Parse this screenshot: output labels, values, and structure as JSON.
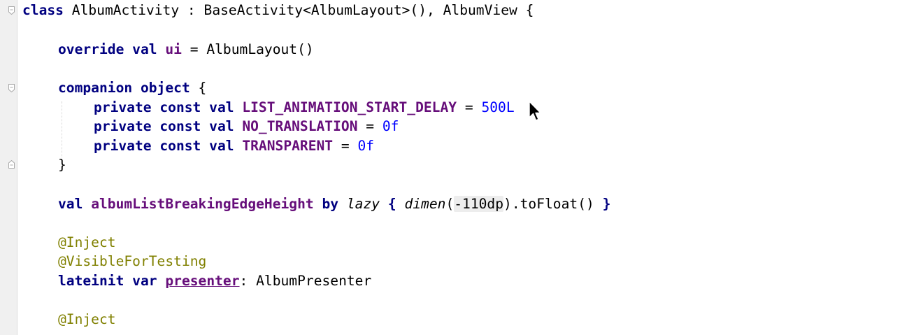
{
  "editor": {
    "lines": [
      [
        {
          "text": "class",
          "style": "kw"
        },
        {
          "text": " AlbumActivity : BaseActivity<AlbumLayout>(), AlbumView {",
          "style": "plain"
        }
      ],
      [
        {
          "text": "override val",
          "style": "kw"
        },
        {
          "text": " ",
          "style": "plain"
        },
        {
          "text": "ui",
          "style": "const"
        },
        {
          "text": " = AlbumLayout()",
          "style": "plain"
        }
      ],
      [
        {
          "text": "companion object",
          "style": "kw"
        },
        {
          "text": " {",
          "style": "plain"
        }
      ],
      [
        {
          "text": "private const val",
          "style": "kw"
        },
        {
          "text": " ",
          "style": "plain"
        },
        {
          "text": "LIST_ANIMATION_START_DELAY",
          "style": "const"
        },
        {
          "text": " = ",
          "style": "plain"
        },
        {
          "text": "500L",
          "style": "num"
        }
      ],
      [
        {
          "text": "private const val",
          "style": "kw"
        },
        {
          "text": " ",
          "style": "plain"
        },
        {
          "text": "NO_TRANSLATION",
          "style": "const"
        },
        {
          "text": " = ",
          "style": "plain"
        },
        {
          "text": "0f",
          "style": "num"
        }
      ],
      [
        {
          "text": "private const val",
          "style": "kw"
        },
        {
          "text": " ",
          "style": "plain"
        },
        {
          "text": "TRANSPARENT",
          "style": "const"
        },
        {
          "text": " = ",
          "style": "plain"
        },
        {
          "text": "0f",
          "style": "num"
        }
      ],
      [
        {
          "text": "}",
          "style": "plain"
        }
      ],
      [
        {
          "text": "val",
          "style": "kw"
        },
        {
          "text": " ",
          "style": "plain"
        },
        {
          "text": "albumListBreakingEdgeHeight",
          "style": "const"
        },
        {
          "text": " ",
          "style": "plain"
        },
        {
          "text": "by",
          "style": "kw"
        },
        {
          "text": " ",
          "style": "plain"
        },
        {
          "text": "lazy",
          "style": "italic"
        },
        {
          "text": " ",
          "style": "plain"
        },
        {
          "text": "{",
          "style": "kw"
        },
        {
          "text": " ",
          "style": "plain"
        },
        {
          "text": "dimen",
          "style": "italic"
        },
        {
          "text": "(",
          "style": "plain"
        },
        {
          "text": "-110dp",
          "style": "hl"
        },
        {
          "text": ").toFloat() ",
          "style": "plain"
        },
        {
          "text": "}",
          "style": "kw"
        }
      ],
      [
        {
          "text": "@Inject",
          "style": "ann"
        }
      ],
      [
        {
          "text": "@VisibleForTesting",
          "style": "ann"
        }
      ],
      [
        {
          "text": "lateinit var",
          "style": "kw"
        },
        {
          "text": " ",
          "style": "plain"
        },
        {
          "text": "presenter",
          "style": "prop-ul"
        },
        {
          "text": ": AlbumPresenter",
          "style": "plain"
        }
      ],
      [
        {
          "text": "@Inject",
          "style": "ann"
        }
      ]
    ]
  }
}
